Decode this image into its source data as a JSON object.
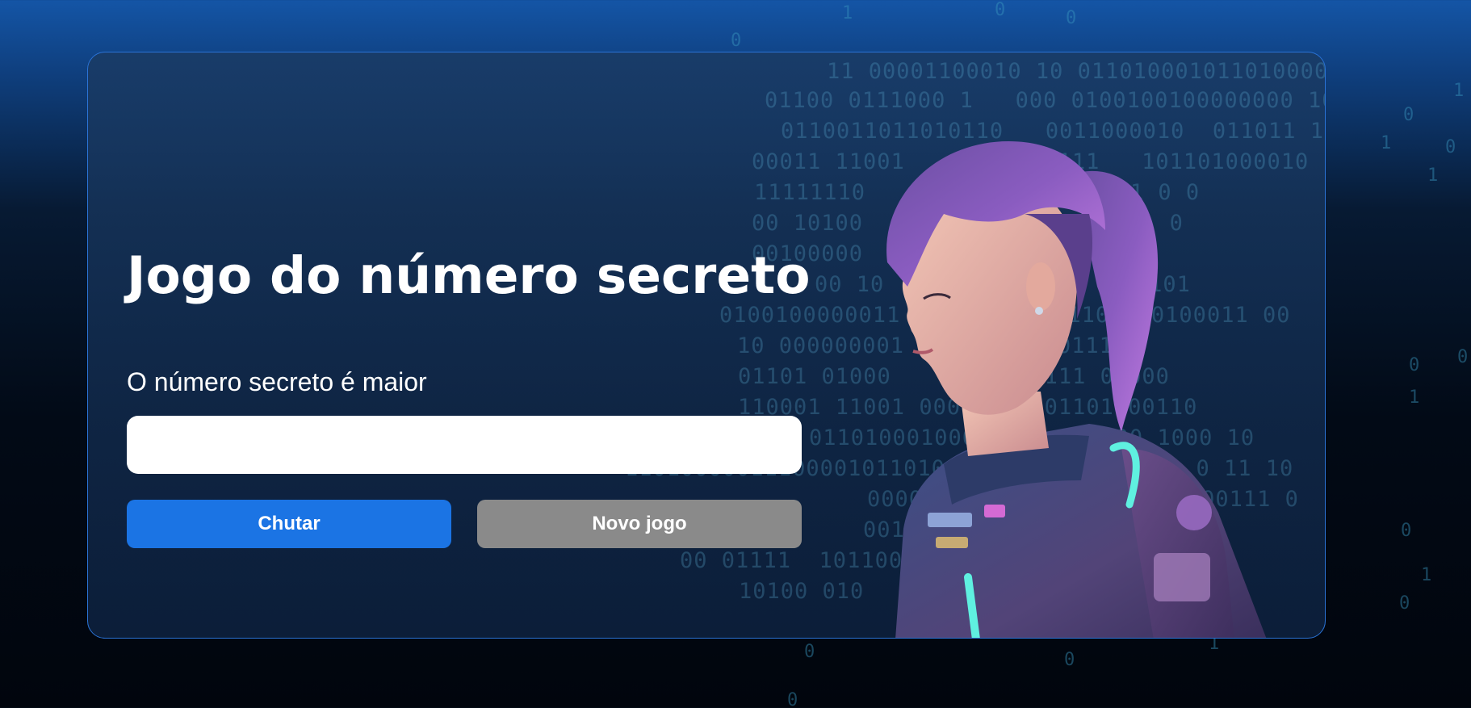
{
  "game": {
    "title": "Jogo do número secreto",
    "message": "O número secreto é maior",
    "input_value": "",
    "input_placeholder": "",
    "guess_button": "Chutar",
    "new_game_button": "Novo jogo"
  },
  "background_binary": {
    "lines": [
      "11 00001100010 10 0110100010110100001",
      "01100 0111000 1   000 0100100100000000 10",
      "0110011011010110   0011000010  011011 1 0",
      "00011 11001    0000101111   101101000010",
      "11111110      00000100000011 0 0",
      "00 10100     0   0001001011   0",
      "00100000      100000",
      "00 10        10001     0101",
      "0100100000011       0000011000 0100011 00",
      "10 000000001      01010011111",
      "01101 01000       1111111 01000",
      "110001 11001 000      01101000110",
      "0110100010000      11000 1000 10",
      "11010000011100001011010      0111 0111 1 0 11 10",
      "00000      0110111 0110000111 0",
      "00110      1 01000 0",
      "00 01111  101100      1011011",
      "10100 010    00101 1 1 10000"
    ],
    "scattered": [
      "1",
      "0",
      "0",
      "0",
      "1",
      "0",
      "1",
      "0",
      "0",
      "1",
      "0",
      "1",
      "0",
      "0",
      "1",
      "0",
      "0",
      "0",
      "1"
    ]
  },
  "colors": {
    "accent": "#1b74e4",
    "secondary_button": "#8a8a8a",
    "card_border": "#2a73d6",
    "text": "#ffffff"
  },
  "illustration": {
    "icon": "astronaut-girl-illustration"
  }
}
